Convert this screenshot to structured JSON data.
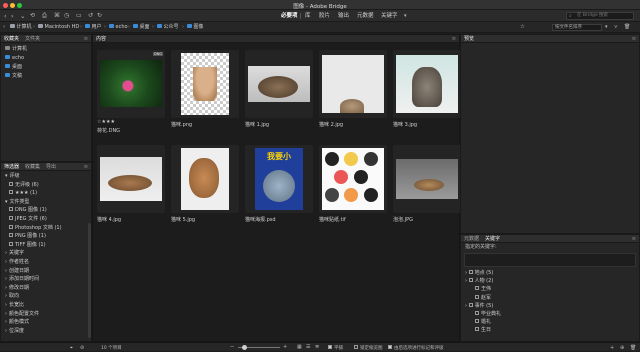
{
  "window": {
    "title": "图像 - Adobe Bridge"
  },
  "toolbar": {
    "workspaces": [
      "必要项",
      "库",
      "胶片",
      "输出",
      "元数据",
      "关键字"
    ],
    "active_workspace": "必要项",
    "search_placeholder": "在 Bridge 搜索"
  },
  "pathbar": {
    "crumbs": [
      "计算机",
      "Macintosh HD",
      "用户",
      "echo",
      "桌面",
      "公众号",
      "图像"
    ],
    "sort_label": "按文件名排序"
  },
  "left_panel_top": {
    "tabs": [
      "收藏夹",
      "文件夹"
    ],
    "items": [
      {
        "label": "计算机",
        "icon": "computer-icon"
      },
      {
        "label": "echo",
        "icon": "home-icon"
      },
      {
        "label": "桌面",
        "icon": "folder-icon"
      },
      {
        "label": "文稿",
        "icon": "folder-icon"
      }
    ]
  },
  "left_panel_bottom": {
    "tabs": [
      "筛选器",
      "收藏集",
      "导出"
    ],
    "rows": [
      {
        "label": "评级",
        "type": "group"
      },
      {
        "label": "无评级 (6)",
        "type": "check"
      },
      {
        "label": "★★★ (1)",
        "type": "check"
      },
      {
        "label": "文件类型",
        "type": "group"
      },
      {
        "label": "DNG 图像 (1)",
        "type": "check"
      },
      {
        "label": "JPEG 文件 (6)",
        "type": "check"
      },
      {
        "label": "Photoshop 文档 (1)",
        "type": "check"
      },
      {
        "label": "PNG 图像 (1)",
        "type": "check"
      },
      {
        "label": "TIFF 图像 (1)",
        "type": "check"
      },
      {
        "label": "关键字",
        "type": "collapsed"
      },
      {
        "label": "作者姓名",
        "type": "collapsed"
      },
      {
        "label": "创建日期",
        "type": "collapsed"
      },
      {
        "label": "添加日期时间",
        "type": "collapsed"
      },
      {
        "label": "修改日期",
        "type": "collapsed"
      },
      {
        "label": "取向",
        "type": "collapsed"
      },
      {
        "label": "长宽比",
        "type": "collapsed"
      },
      {
        "label": "颜色配置文件",
        "type": "collapsed"
      },
      {
        "label": "颜色模式",
        "type": "collapsed"
      },
      {
        "label": "位深度",
        "type": "collapsed"
      }
    ]
  },
  "content": {
    "title": "内容",
    "items": [
      {
        "name": "荷花.DNG",
        "rating": "☆★★★",
        "badge": "DNG"
      },
      {
        "name": "猫咪.png"
      },
      {
        "name": "猫咪 1.jpg"
      },
      {
        "name": "猫咪 2.jpg"
      },
      {
        "name": "猫咪 3.jpg"
      },
      {
        "name": "猫咪 4.jpg"
      },
      {
        "name": "猫咪 5.jpg"
      },
      {
        "name": "猫咪海报.psd",
        "poster_text": "我要小"
      },
      {
        "name": "猫咪贴纸.tif"
      },
      {
        "name": "泡泡.JPG"
      }
    ]
  },
  "preview": {
    "tab": "预览"
  },
  "metadata": {
    "tabs": [
      "元数据",
      "关键字"
    ],
    "assigned_label": "指定的关键字:",
    "tree": [
      {
        "label": "地点 (5)",
        "level": 0
      },
      {
        "label": "人物 (2)",
        "level": 0
      },
      {
        "label": "王伟",
        "level": 1
      },
      {
        "label": "赵军",
        "level": 1
      },
      {
        "label": "事件 (5)",
        "level": 0
      },
      {
        "label": "毕业典礼",
        "level": 1
      },
      {
        "label": "婚礼",
        "level": 1
      },
      {
        "label": "生日",
        "level": 1
      }
    ]
  },
  "statusbar": {
    "count": "10 个项目",
    "view_tiles": "平铺",
    "lock_thumb": "锁定缩览图",
    "thumb_meta": "由后选项进行标记和评级"
  }
}
